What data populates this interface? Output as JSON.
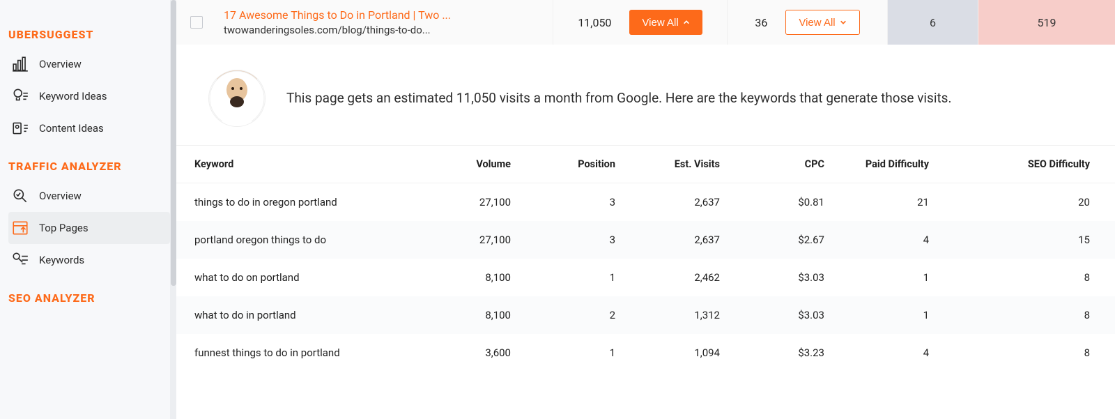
{
  "sidebar": {
    "sections": [
      {
        "title": "UBERSUGGEST",
        "items": [
          {
            "label": "Overview"
          },
          {
            "label": "Keyword Ideas"
          },
          {
            "label": "Content Ideas"
          }
        ]
      },
      {
        "title": "TRAFFIC ANALYZER",
        "items": [
          {
            "label": "Overview"
          },
          {
            "label": "Top Pages"
          },
          {
            "label": "Keywords"
          }
        ]
      },
      {
        "title": "SEO ANALYZER",
        "items": []
      }
    ]
  },
  "topbar": {
    "page_title": "17 Awesome Things to Do in Portland | Two ...",
    "page_url": "twowanderingsoles.com/blog/things-to-do...",
    "est_visits": "11,050",
    "view_all_up_label": "View All",
    "backlinks": "36",
    "view_all_down_label": "View All",
    "fb_shares": "6",
    "pin_shares": "519"
  },
  "message": "This page gets an estimated 11,050 visits a month from Google. Here are the keywords that generate those visits.",
  "table": {
    "headers": {
      "keyword": "Keyword",
      "volume": "Volume",
      "position": "Position",
      "est_visits": "Est. Visits",
      "cpc": "CPC",
      "paid_difficulty": "Paid Difficulty",
      "seo_difficulty": "SEO Difficulty"
    },
    "rows": [
      {
        "keyword": "things to do in oregon portland",
        "volume": "27,100",
        "position": "3",
        "est_visits": "2,637",
        "cpc": "$0.81",
        "pd": "21",
        "sd": "20"
      },
      {
        "keyword": "portland oregon things to do",
        "volume": "27,100",
        "position": "3",
        "est_visits": "2,637",
        "cpc": "$2.67",
        "pd": "4",
        "sd": "15"
      },
      {
        "keyword": "what to do on portland",
        "volume": "8,100",
        "position": "1",
        "est_visits": "2,462",
        "cpc": "$3.03",
        "pd": "1",
        "sd": "8"
      },
      {
        "keyword": "what to do in portland",
        "volume": "8,100",
        "position": "2",
        "est_visits": "1,312",
        "cpc": "$3.03",
        "pd": "1",
        "sd": "8"
      },
      {
        "keyword": "funnest things to do in portland",
        "volume": "3,600",
        "position": "1",
        "est_visits": "1,094",
        "cpc": "$3.23",
        "pd": "4",
        "sd": "8"
      }
    ]
  }
}
